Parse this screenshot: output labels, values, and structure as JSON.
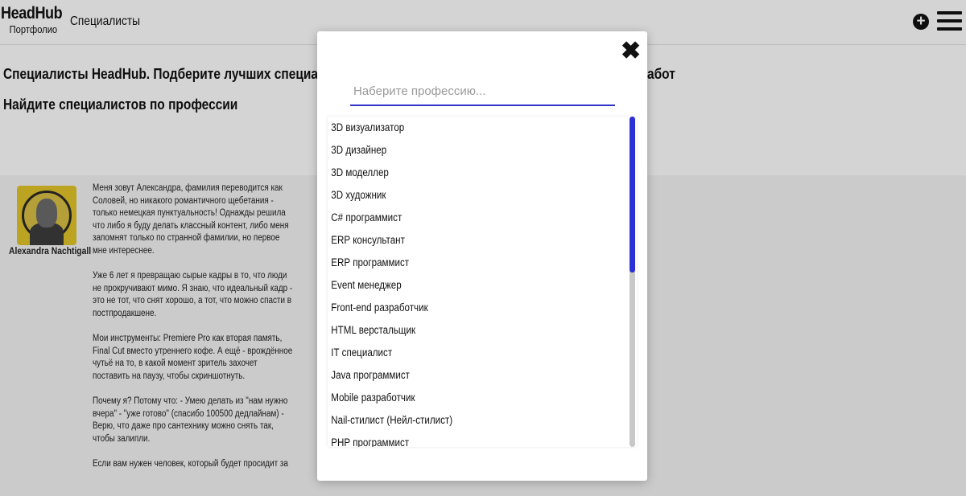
{
  "header": {
    "logo_title": "HeadHub",
    "logo_sub": "Портфолио",
    "nav_link": "Специалисты",
    "add_icon": "plus-circle-icon",
    "menu_icon": "hamburger-icon"
  },
  "intro": {
    "text": "Специалисты HeadHub. Подберите лучших специалистов и",
    "tail": "абот",
    "section_title": "Найдите специалистов по профессии"
  },
  "profile": {
    "author_name": "Alexandra Nachtigall",
    "bio": [
      "Меня зовут Александра, фамилия переводится как Соловей, но никакого романтичного щебетания - только немецкая пунктуальность! Однажды решила что либо я буду делать классный контент, либо меня запомнят только по странной фамилии, но первое мне интереснее.",
      "Уже 6 лет я превращаю сырые кадры в то, что люди не прокручивают мимо. Я знаю, что идеальный кадр - это не тот, что снят хорошо, а тот, что можно спасти в постпродакшене.",
      "Мои инструменты: Premiere Pro как вторая память, Final Cut вместо утреннего кофе. А ещё - врождённое чутьё на то, в какой момент зритель захочет поставить на паузу, чтобы скриншотнуть.",
      "Почему я? Потому что: - Умею делать из \"нам нужно вчера\" - \"уже готово\" (спасибо 100500 дедлайнам) - Верю, что даже про сантехнику можно снять так, чтобы залипли.",
      "Если вам нужен человек, который будет просидит за"
    ]
  },
  "modal": {
    "close_icon": "close-icon",
    "search_placeholder": "Наберите профессию...",
    "search_value": "",
    "professions": [
      "3D визуализатор",
      "3D дизайнер",
      "3D моделлер",
      "3D художник",
      "C# программист",
      "ERP консультант",
      "ERP программист",
      "Event менеджер",
      "Front-end разработчик",
      "HTML верстальщик",
      "IT специалист",
      "Java программист",
      "Mobile разработчик",
      "Nail-стилист (Нейл-стилист)",
      "PHP программист"
    ],
    "scroll_position": 0,
    "colors": {
      "accent": "#2b2fd6",
      "input_underline": "#3133c8"
    }
  }
}
